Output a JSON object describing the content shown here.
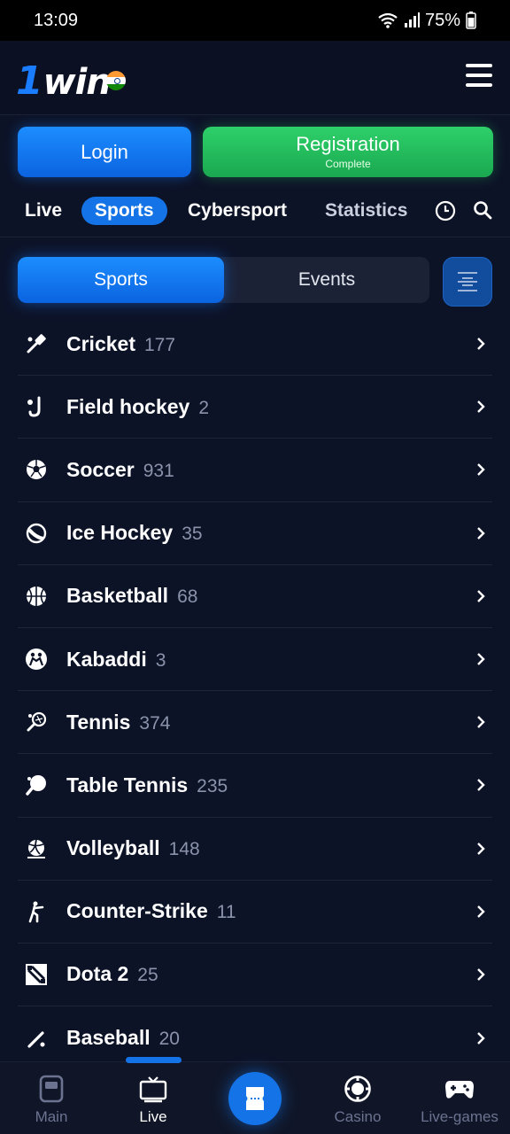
{
  "status_bar": {
    "time": "13:09",
    "battery": "75%"
  },
  "header": {
    "logo_prefix": "1",
    "logo_text": "win"
  },
  "auth": {
    "login_label": "Login",
    "register_label": "Registration",
    "register_sub": "Complete"
  },
  "nav_tabs": [
    {
      "label": "Live"
    },
    {
      "label": "Sports"
    },
    {
      "label": "Cybersport"
    },
    {
      "label": "Statistics"
    }
  ],
  "segment": {
    "sports_label": "Sports",
    "events_label": "Events"
  },
  "sports": [
    {
      "name": "Cricket",
      "count": "177",
      "icon": "cricket-icon"
    },
    {
      "name": "Field hockey",
      "count": "2",
      "icon": "field-hockey-icon"
    },
    {
      "name": "Soccer",
      "count": "931",
      "icon": "soccer-ball-icon"
    },
    {
      "name": "Ice Hockey",
      "count": "35",
      "icon": "ice-hockey-icon"
    },
    {
      "name": "Basketball",
      "count": "68",
      "icon": "basketball-icon"
    },
    {
      "name": "Kabaddi",
      "count": "3",
      "icon": "kabaddi-icon"
    },
    {
      "name": "Tennis",
      "count": "374",
      "icon": "tennis-icon"
    },
    {
      "name": "Table Tennis",
      "count": "235",
      "icon": "table-tennis-icon"
    },
    {
      "name": "Volleyball",
      "count": "148",
      "icon": "volleyball-icon"
    },
    {
      "name": "Counter-Strike",
      "count": "11",
      "icon": "counter-strike-icon"
    },
    {
      "name": "Dota 2",
      "count": "25",
      "icon": "dota-icon"
    },
    {
      "name": "Baseball",
      "count": "20",
      "icon": "baseball-icon"
    }
  ],
  "bottom_nav": [
    {
      "label": "Main"
    },
    {
      "label": "Live"
    },
    {
      "label": "Casino"
    },
    {
      "label": "Live-games"
    }
  ],
  "colors": {
    "background": "#0d1327",
    "accent": "#1473e6",
    "register": "#22b95b",
    "count": "#8a93ab"
  }
}
